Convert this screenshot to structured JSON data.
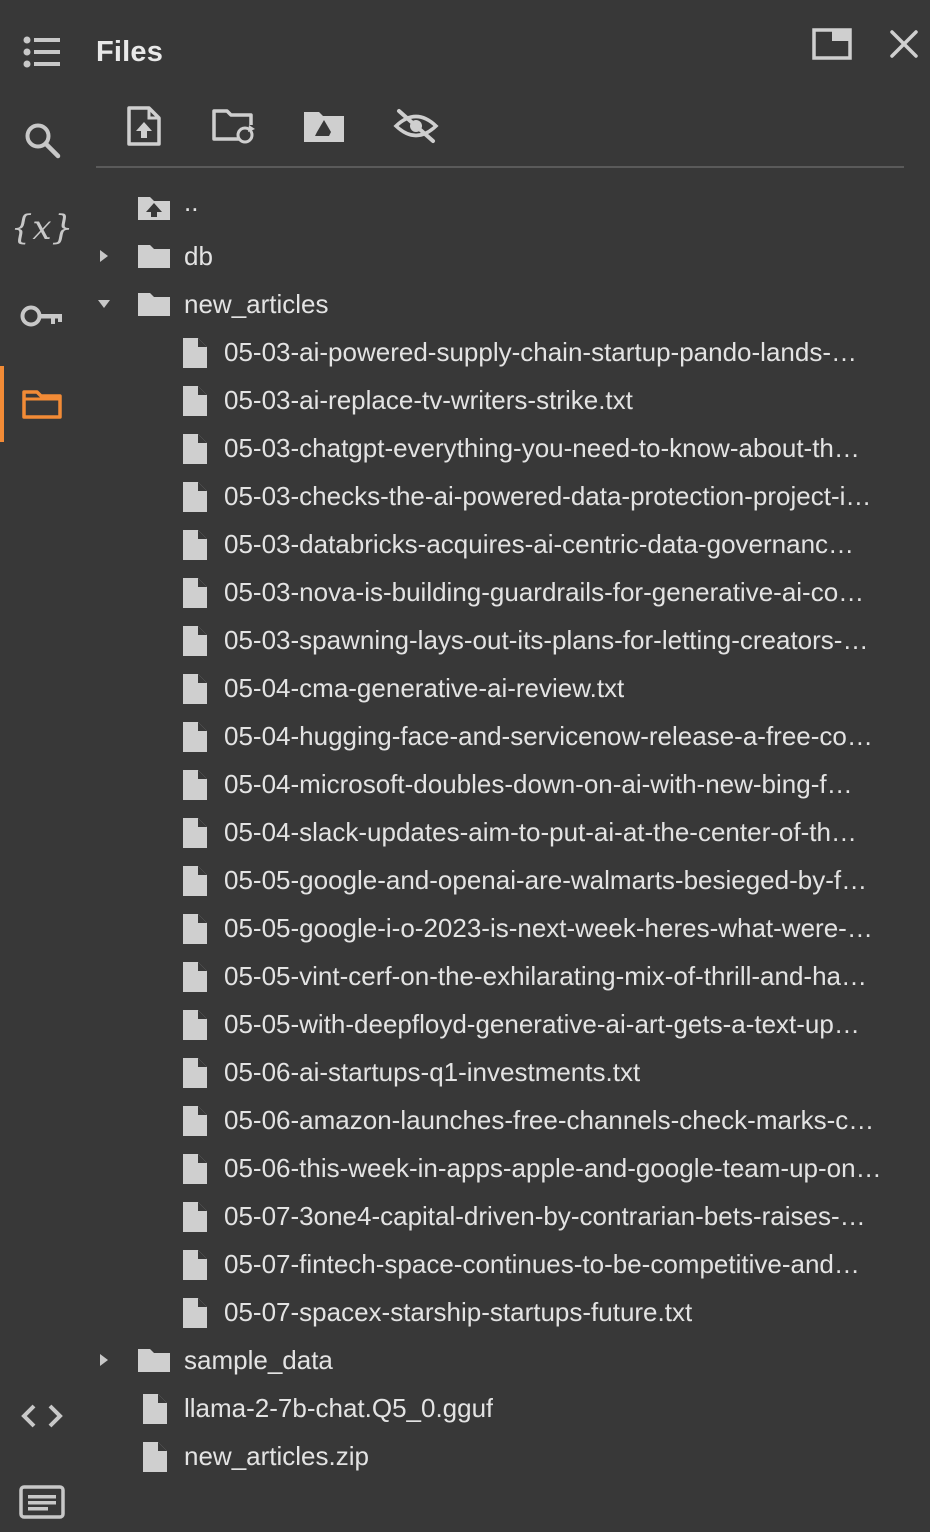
{
  "panel": {
    "title": "Files"
  },
  "rail": {
    "items": [
      {
        "name": "table-of-contents-icon",
        "active": false
      },
      {
        "name": "search-icon",
        "active": false
      },
      {
        "name": "variables-icon",
        "active": false
      },
      {
        "name": "secrets-key-icon",
        "active": false
      },
      {
        "name": "folder-icon",
        "active": true
      },
      {
        "name": "code-snippets-icon",
        "active": false
      },
      {
        "name": "terminal-icon",
        "active": false
      }
    ],
    "variables_glyph": "{x}",
    "accent_color": "#f28b36"
  },
  "header_buttons": [
    {
      "name": "open-in-tab-icon"
    },
    {
      "name": "close-icon"
    }
  ],
  "toolbar": [
    {
      "name": "upload-file-icon"
    },
    {
      "name": "refresh-folder-icon"
    },
    {
      "name": "mount-drive-icon"
    },
    {
      "name": "hide-files-icon"
    }
  ],
  "tree": {
    "parent": "..",
    "folders": {
      "db": "db",
      "new_articles": "new_articles",
      "sample_data": "sample_data"
    },
    "new_articles_files": [
      "05-03-ai-powered-supply-chain-startup-pando-lands-…",
      "05-03-ai-replace-tv-writers-strike.txt",
      "05-03-chatgpt-everything-you-need-to-know-about-th…",
      "05-03-checks-the-ai-powered-data-protection-project-i…",
      "05-03-databricks-acquires-ai-centric-data-governanc…",
      "05-03-nova-is-building-guardrails-for-generative-ai-co…",
      "05-03-spawning-lays-out-its-plans-for-letting-creators-…",
      "05-04-cma-generative-ai-review.txt",
      "05-04-hugging-face-and-servicenow-release-a-free-co…",
      "05-04-microsoft-doubles-down-on-ai-with-new-bing-f…",
      "05-04-slack-updates-aim-to-put-ai-at-the-center-of-th…",
      "05-05-google-and-openai-are-walmarts-besieged-by-f…",
      "05-05-google-i-o-2023-is-next-week-heres-what-were-…",
      "05-05-vint-cerf-on-the-exhilarating-mix-of-thrill-and-ha…",
      "05-05-with-deepfloyd-generative-ai-art-gets-a-text-up…",
      "05-06-ai-startups-q1-investments.txt",
      "05-06-amazon-launches-free-channels-check-marks-c…",
      "05-06-this-week-in-apps-apple-and-google-team-up-on…",
      "05-07-3one4-capital-driven-by-contrarian-bets-raises-…",
      "05-07-fintech-space-continues-to-be-competitive-and…",
      "05-07-spacex-starship-startups-future.txt"
    ],
    "root_files": [
      "llama-2-7b-chat.Q5_0.gguf",
      "new_articles.zip"
    ]
  }
}
